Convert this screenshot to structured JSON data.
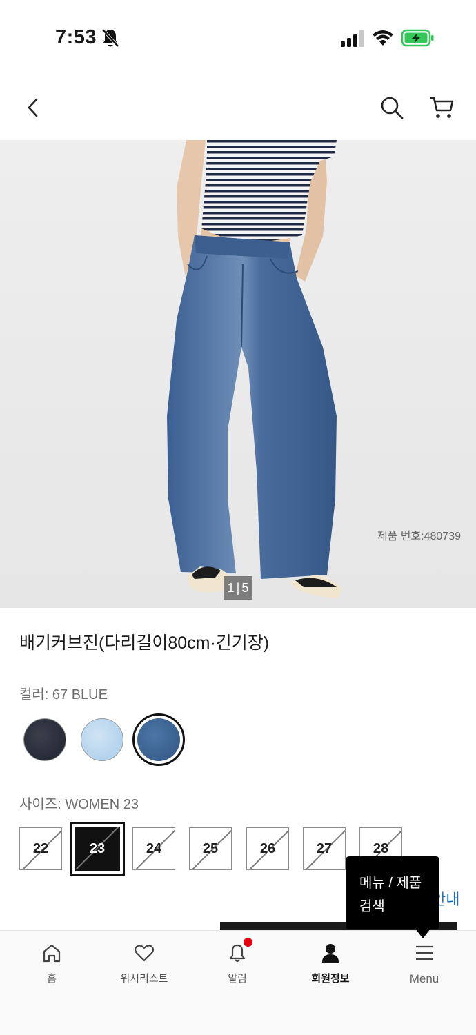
{
  "status_bar": {
    "time": "7:53",
    "icons": [
      "bell-off-icon",
      "cellular-signal-icon",
      "wifi-icon",
      "battery-charging-icon"
    ],
    "battery_color": "#34c759"
  },
  "header": {
    "icons": [
      "back-chevron-icon",
      "search-icon",
      "cart-icon"
    ]
  },
  "product": {
    "product_number": "제품 번호:480739",
    "image_counter_current": "1",
    "image_counter_total": "5",
    "title": "배기커브진(다리길이80cm·긴기장)",
    "color_label": "컬러: 67 BLUE",
    "colors": [
      {
        "name": "dark navy",
        "hex": "#2a2f3a"
      },
      {
        "name": "light blue",
        "hex": "#bcd8ef"
      },
      {
        "name": "67 BLUE",
        "hex": "#3e6695",
        "selected": true
      }
    ],
    "size_label": "사이즈: WOMEN 23",
    "sizes": [
      {
        "label": "22",
        "available": false,
        "selected": false
      },
      {
        "label": "23",
        "available": false,
        "selected": true
      },
      {
        "label": "24",
        "available": false,
        "selected": false
      },
      {
        "label": "25",
        "available": false,
        "selected": false
      },
      {
        "label": "26",
        "available": false,
        "selected": false
      },
      {
        "label": "27",
        "available": false,
        "selected": false
      },
      {
        "label": "28",
        "available": false,
        "selected": false
      }
    ],
    "size_guide_partial": "안내"
  },
  "tooltip": {
    "line1": "메뉴 / 제품",
    "line2": "검색"
  },
  "bottom_nav": [
    {
      "label": "홈",
      "icon": "home-icon"
    },
    {
      "label": "위시리스트",
      "icon": "heart-icon"
    },
    {
      "label": "알림",
      "icon": "bell-icon",
      "badge": true
    },
    {
      "label": "회원정보",
      "icon": "person-icon",
      "active": true
    },
    {
      "label": "Menu",
      "icon": "hamburger-menu-icon"
    }
  ],
  "accent_colors": {
    "link": "#1a6ec0",
    "notification_dot": "#e60012",
    "selected": "#111111"
  }
}
